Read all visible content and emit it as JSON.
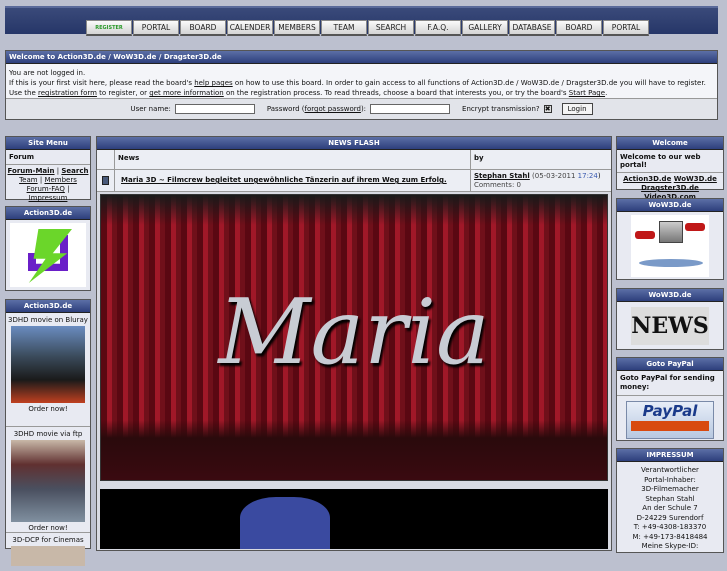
{
  "nav": [
    "REGISTER",
    "PORTAL",
    "BOARD",
    "CALENDER",
    "MEMBERS",
    "TEAM",
    "SEARCH",
    "F.A.Q.",
    "GALLERY",
    "DATABASE",
    "BOARD",
    "PORTAL"
  ],
  "welcome": {
    "title": "Welcome to Action3D.de / WoW3D.de / Dragster3D.de",
    "not_logged": "You are not logged in.",
    "t1": "If this is your first visit here, please read the board's ",
    "help": "help pages",
    "t2": " on how to use this board. In order to gain access to all functions of Action3D.de / WoW3D.de / Dragster3D.de you will have to register. Use the ",
    "regform": "registration form",
    "t3": " to register, or ",
    "more": "get more information",
    "t4": " on the registration process. To read threads, choose a board that interests you, or try the board's ",
    "start": "Start Page",
    "t5": ".",
    "user_label": "User name:",
    "pw_label": "Password (",
    "forgot": "forgot password",
    "pw_end": "):",
    "encrypt": "Encrypt transmission?",
    "login": "Login"
  },
  "site_menu": {
    "title": "Site Menu",
    "forum": "Forum",
    "main": "Forum-Main",
    "search": "Search",
    "team": "Team",
    "members": "Members",
    "faq": "Forum-FAQ",
    "impressum": "Impressum",
    "sep": "|"
  },
  "action1": {
    "title": "Action3D.de"
  },
  "action2": {
    "title": "Action3D.de",
    "items": [
      {
        "label": "3DHD movie on Bluray",
        "cta": "Order now!"
      },
      {
        "label": "3DHD movie via ftp",
        "cta": "Order now!"
      },
      {
        "label": "3D-DCP for Cinemas"
      }
    ]
  },
  "news": {
    "title": "NEWS FLASH",
    "col_news": "News",
    "col_by": "by",
    "item": {
      "title": "Maria 3D ~ Filmcrew begleitet ungewöhnliche Tänzerin auf ihrem Weg zum Erfolg.",
      "author": "Stephan Stahl",
      "date": "(05-03-2011 ",
      "time": "17:24",
      "date_end": ")",
      "comments": "Comments: 0"
    },
    "image_text": "Maria"
  },
  "right": {
    "welcome_title": "Welcome",
    "welcome_text": "Welcome to our web portal!",
    "links": [
      "Action3D.de",
      "WoW3D.de",
      "Dragster3D.de",
      "Video3D.com"
    ],
    "wow1": "WoW3D.de",
    "wow2": "WoW3D.de",
    "news_img": "NEWS",
    "paypal_title": "Goto PayPal",
    "paypal_text": "Goto PayPal for sending money:",
    "paypal_logo": "PayPal",
    "imp_title": "IMPRESSUM",
    "imp_lines": [
      "Verantwortlicher",
      "Portal-Inhaber:",
      "3D-Filmemacher",
      "Stephan Stahl",
      "An der Schule 7",
      "D-24229 Surendorf",
      "T: +49-4308-183370",
      "M: +49-173-8418484",
      "Meine Skype-ID:"
    ]
  }
}
